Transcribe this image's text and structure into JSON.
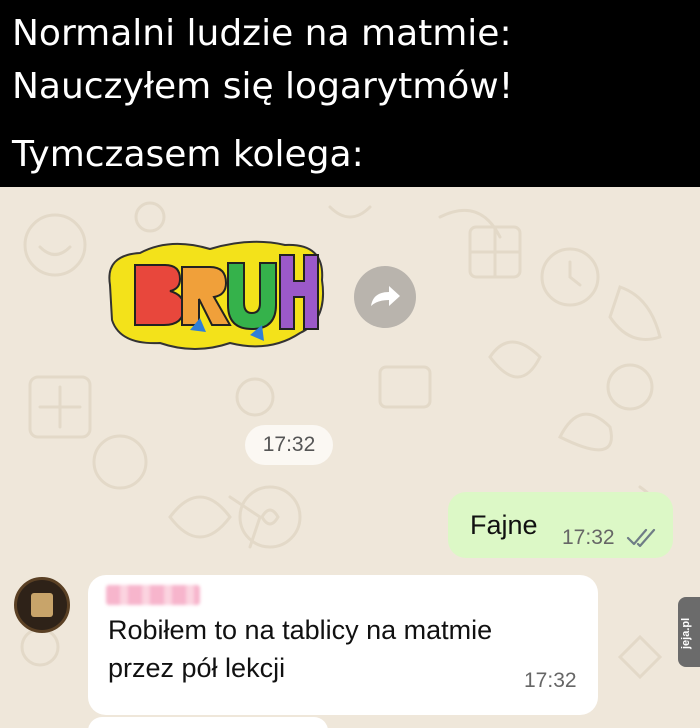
{
  "caption": {
    "line1": "Normalni ludzie na matmie:",
    "line2": "Nauczyłem się logarytmów!",
    "line3": "Tymczasem kolega:"
  },
  "chat": {
    "sticker": {
      "text": "BRUH",
      "icon": "graffiti-sticker"
    },
    "forward_icon": "forward-arrow-icon",
    "time_separator": "17:32",
    "outgoing": {
      "text": "Fajne",
      "time": "17:32",
      "status_icon": "double-check-icon"
    },
    "incoming": {
      "line1": "Robiłem to na tablicy na matmie",
      "line2": "przez pół lekcji",
      "time": "17:32"
    },
    "watermark": "jeja.pl"
  },
  "colors": {
    "caption_bg": "#000000",
    "chat_bg": "#efe7da",
    "outgoing_bubble": "#dcf8c6",
    "incoming_bubble": "#ffffff"
  }
}
